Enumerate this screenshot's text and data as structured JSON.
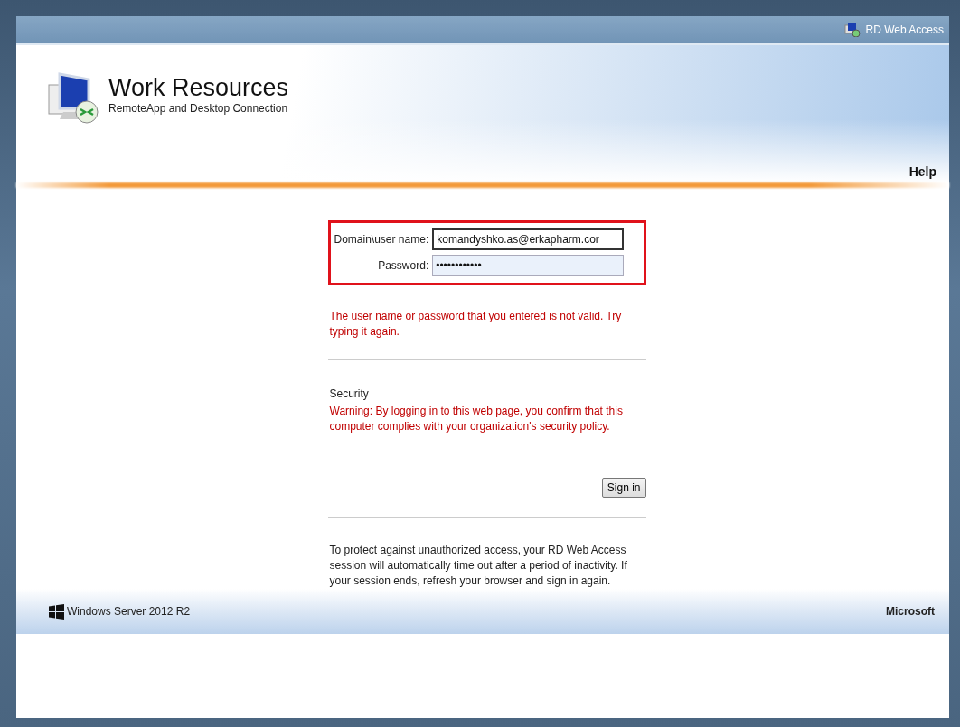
{
  "top_bar": {
    "link": "RD Web Access"
  },
  "header": {
    "title": "Work Resources",
    "subtitle": "RemoteApp and Desktop Connection",
    "help_link": "Help"
  },
  "login": {
    "fields": [
      {
        "label": "Domain\\user name:",
        "value": "komandyshko.as@erkapharm.cor",
        "focused": true
      },
      {
        "label": "Password:",
        "value": "••••••••••••",
        "focused": false
      }
    ],
    "error": "The user name or password that you entered is not valid. Try typing it again.",
    "security_heading": "Security",
    "security_warning": "Warning: By logging in to this web page, you confirm that this computer complies with your organization's security policy.",
    "sign_in_button": "Sign in",
    "timeout_notice": "To protect against unauthorized access, your RD Web Access session will automatically time out after a period of inactivity. If your session ends, refresh your browser and sign in again."
  },
  "footer": {
    "product": "Windows Server 2012 R2",
    "vendor": "Microsoft"
  }
}
